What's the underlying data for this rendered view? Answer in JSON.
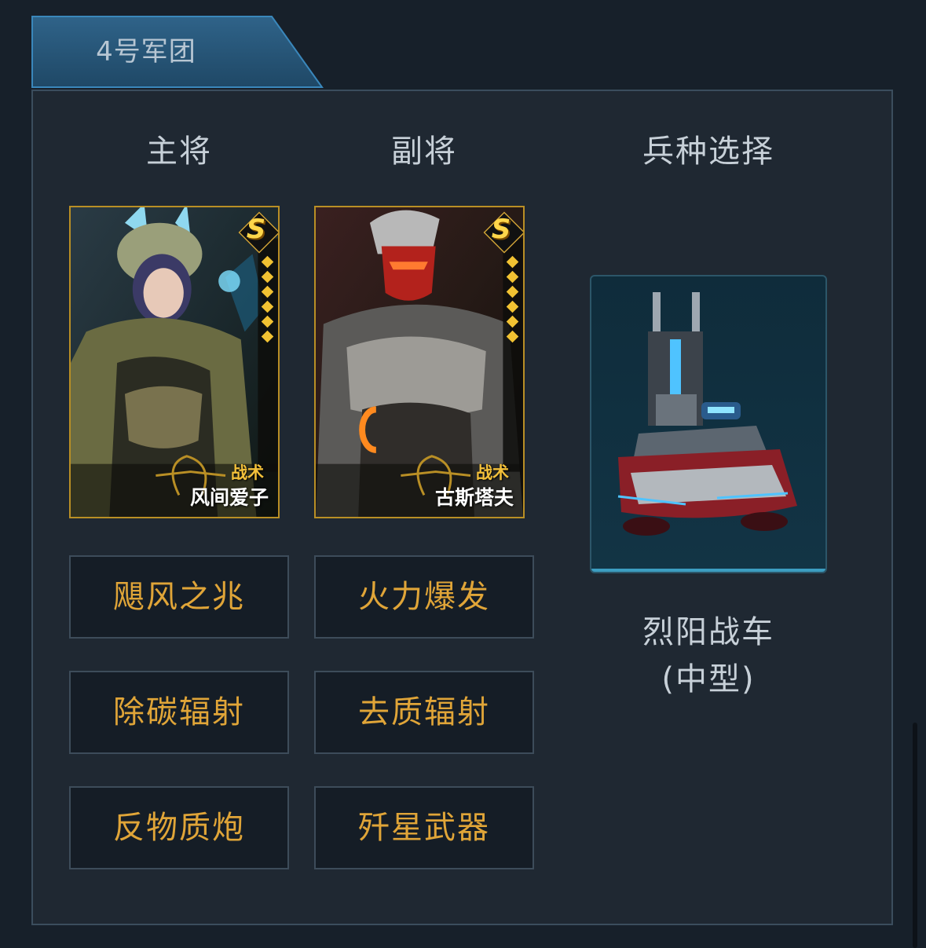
{
  "tab": {
    "label": "4号军团"
  },
  "columns": {
    "main_general": "主将",
    "vice_general": "副将",
    "unit_select": "兵种选择"
  },
  "main_card": {
    "rank": "S",
    "type": "战术",
    "name": "风间爱子",
    "stars": 6
  },
  "vice_card": {
    "rank": "S",
    "type": "战术",
    "name": "古斯塔夫",
    "stars": 6
  },
  "skills": {
    "main": [
      "飓风之兆",
      "除碳辐射",
      "反物质炮"
    ],
    "vice": [
      "火力爆发",
      "去质辐射",
      "歼星武器"
    ]
  },
  "unit": {
    "name_line1": "烈阳战车",
    "name_line2": "(中型)"
  },
  "colors": {
    "skill_text": "#e0a538",
    "card_border": "#b98f25",
    "tab_fill": "#2b5c82"
  }
}
